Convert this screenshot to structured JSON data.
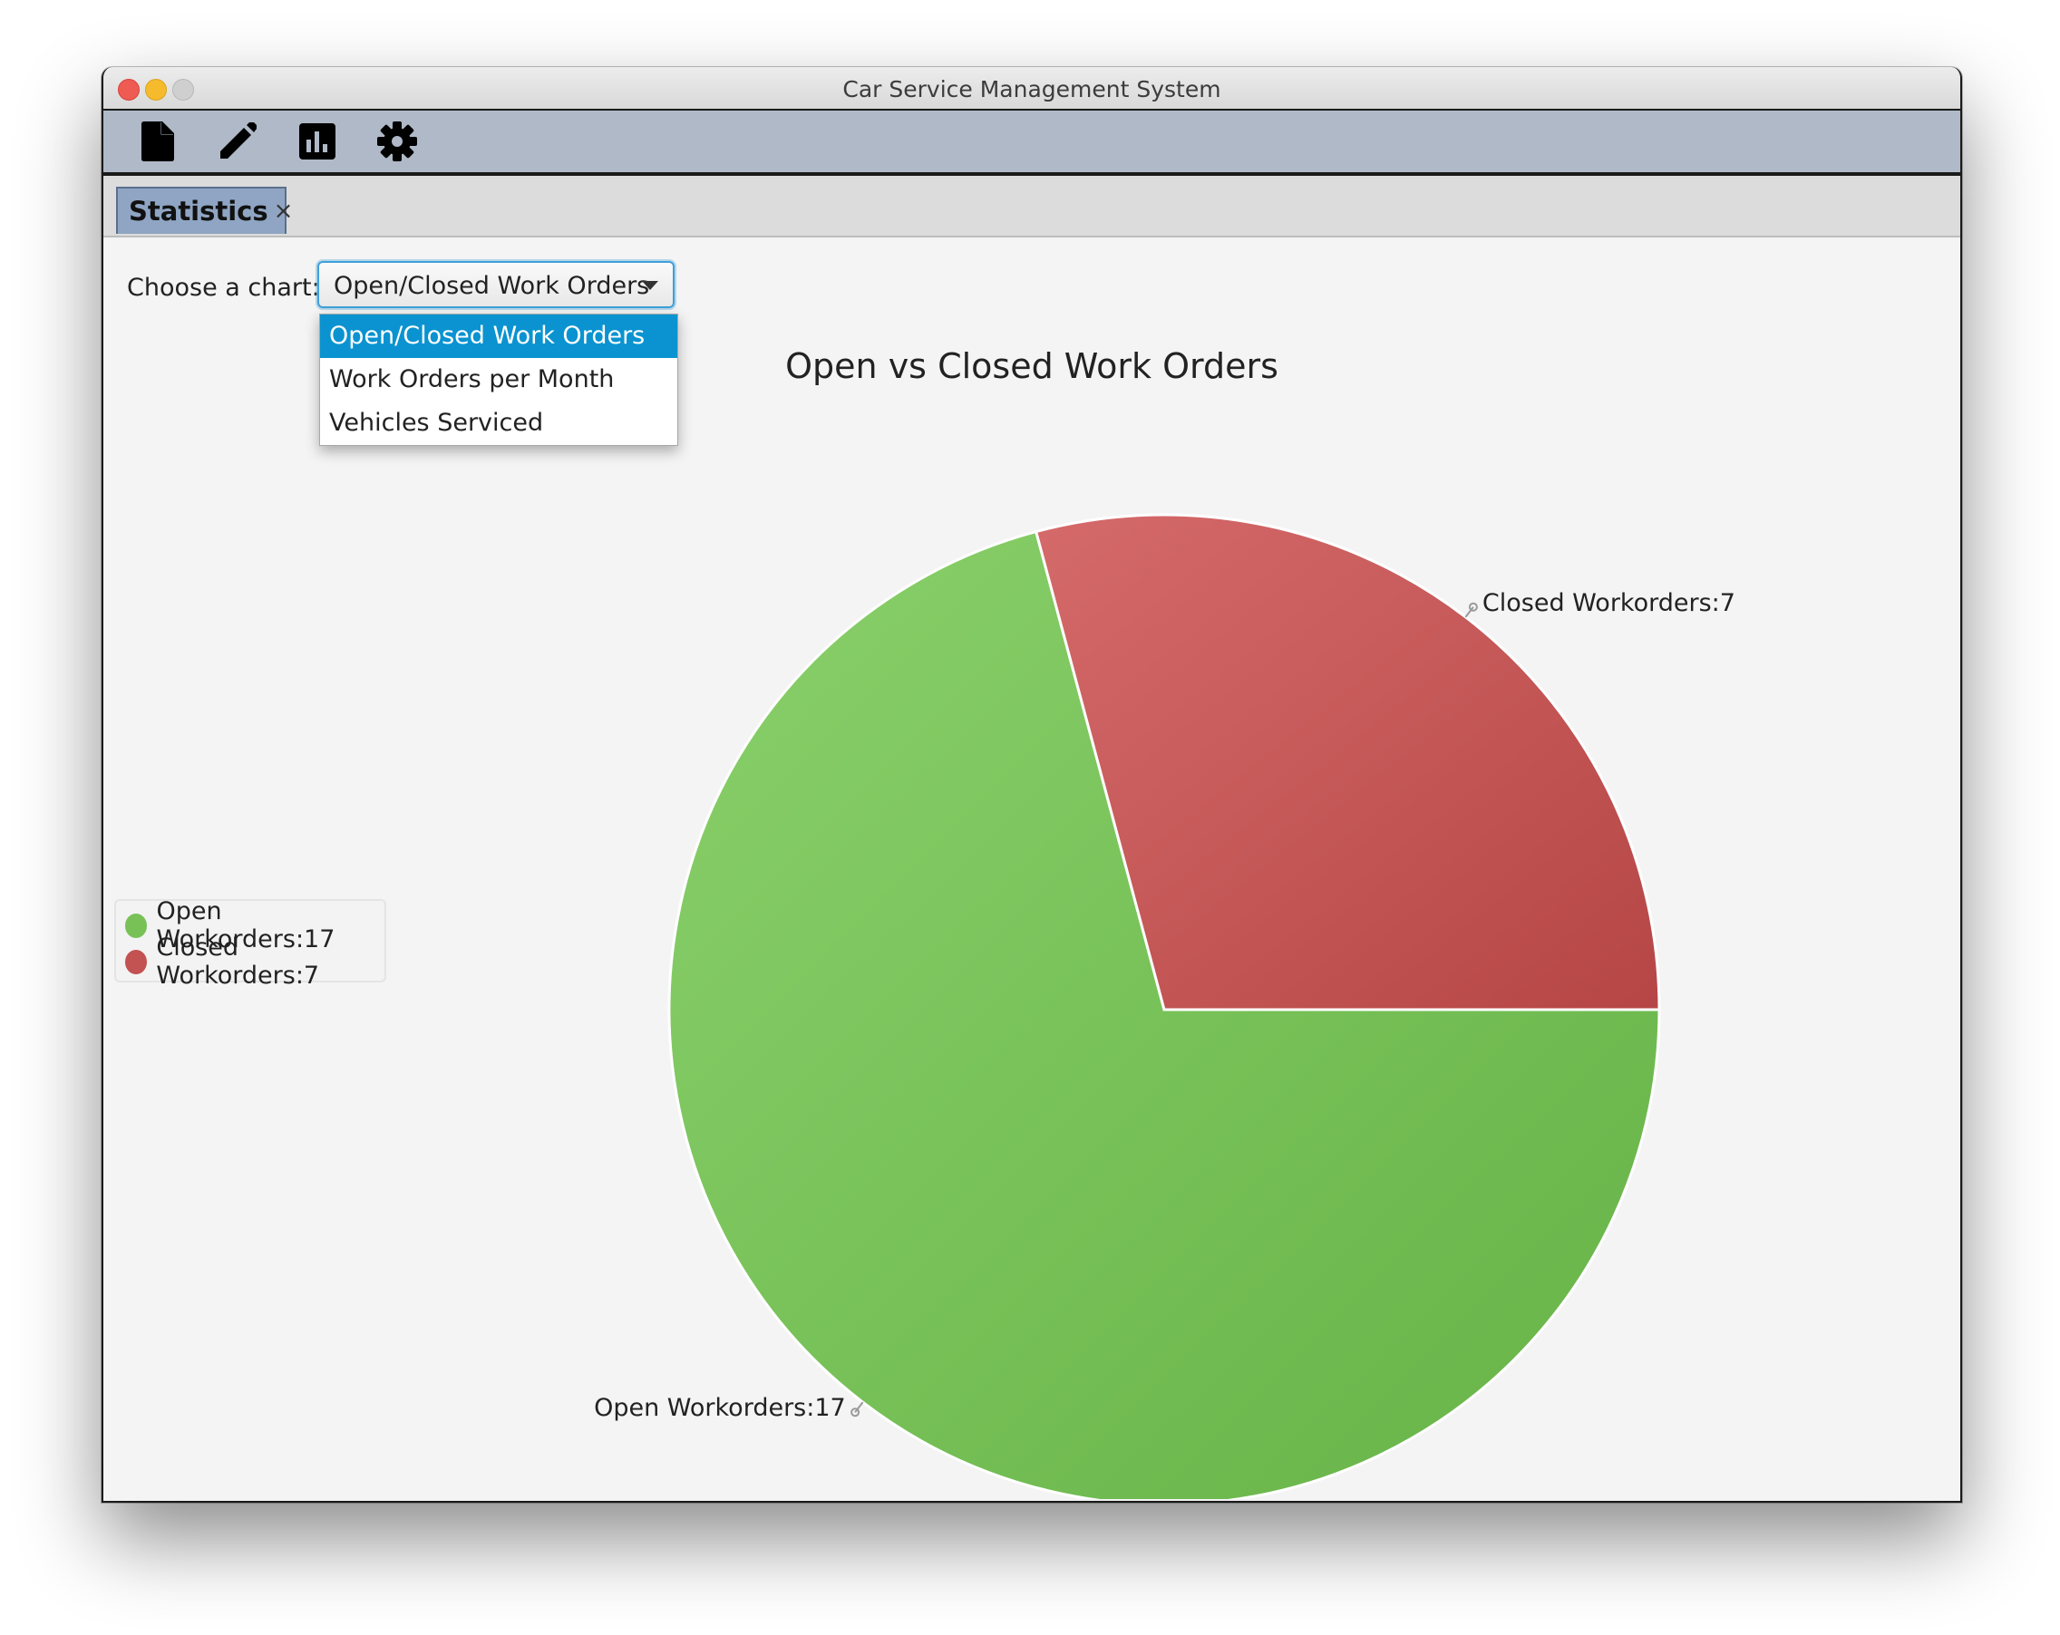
{
  "window": {
    "title": "Car Service Management System"
  },
  "toolbar": {
    "buttons": [
      {
        "icon": "document-icon"
      },
      {
        "icon": "pencil-icon"
      },
      {
        "icon": "bar-chart-icon"
      },
      {
        "icon": "gear-icon"
      }
    ]
  },
  "tabs": [
    {
      "label": "Statistics",
      "close": "×"
    }
  ],
  "controls": {
    "choose_label": "Choose a chart:",
    "selected": "Open/Closed Work Orders",
    "options": [
      "Open/Closed Work Orders",
      "Work Orders per Month",
      "Vehicles Serviced"
    ]
  },
  "chart_data": {
    "type": "pie",
    "title": "Open vs Closed Work Orders",
    "slices": [
      {
        "label": "Open Workorders:17",
        "value": 17,
        "color": "#78c157"
      },
      {
        "label": "Closed Workorders:7",
        "value": 7,
        "color": "#c35252"
      }
    ],
    "legend": {
      "position": "left"
    }
  },
  "colors": {
    "toolbar": "#b0b9c7",
    "tab": "#8fa5c3",
    "selection": "#0a93d0",
    "open_light": "#8ad06b",
    "open_dark": "#66b347",
    "closed_light": "#d56a6a",
    "closed_dark": "#b64646"
  }
}
